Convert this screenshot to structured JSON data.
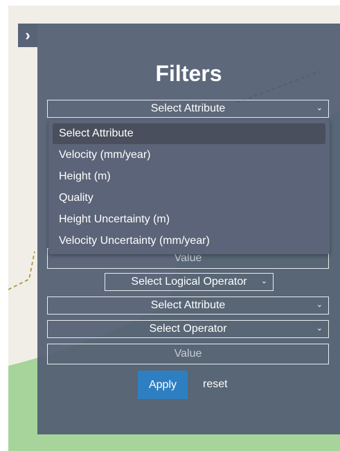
{
  "colors": {
    "panel_bg": "#525e72",
    "dropdown_bg": "#5b6478",
    "dropdown_selected": "#4a4f5d",
    "apply_button": "#2e7fc2",
    "map_land": "#f1eee7",
    "map_forest": "#a6d49a"
  },
  "toggle": {
    "icon": "chevron-right-icon",
    "glyph": "›"
  },
  "panel": {
    "title": "Filters"
  },
  "filter1": {
    "attribute": {
      "value": "Select Attribute",
      "options": [
        "Select Attribute",
        "Velocity (mm/year)",
        "Height (m)",
        "Quality",
        "Height Uncertainty (m)",
        "Velocity Uncertainty (mm/year)"
      ]
    },
    "value_placeholder": "Value"
  },
  "logical_operator": {
    "value": "Select Logical Operator"
  },
  "filter2": {
    "attribute": {
      "value": "Select Attribute"
    },
    "operator": {
      "value": "Select Operator"
    },
    "value_placeholder": "Value"
  },
  "actions": {
    "apply_label": "Apply",
    "reset_label": "reset"
  },
  "icons": {
    "chevron_down": "⌄"
  }
}
